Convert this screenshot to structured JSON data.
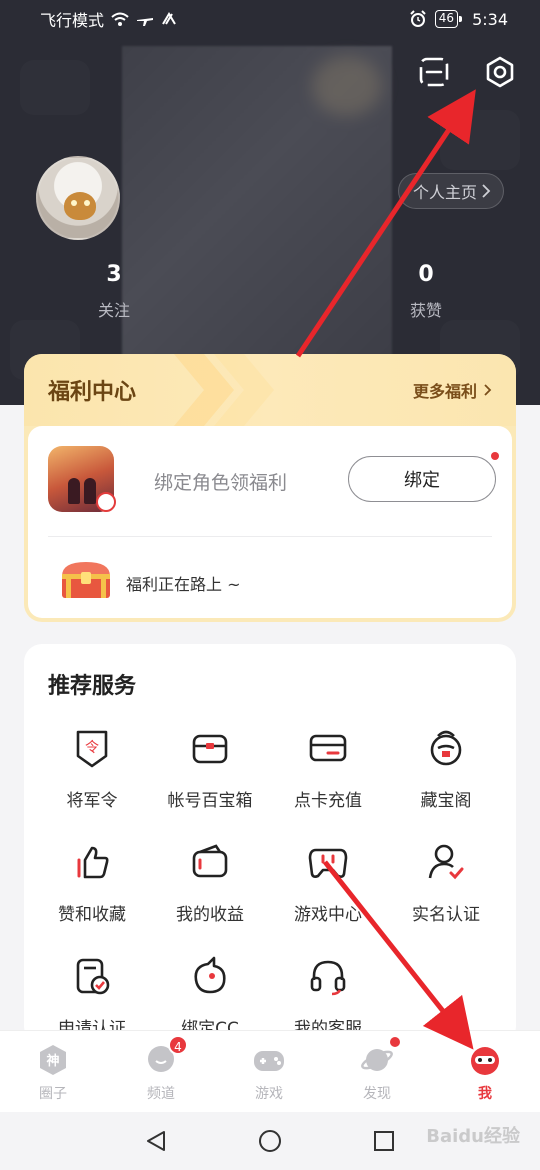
{
  "status_bar": {
    "carrier": "飞行模式",
    "battery": "46",
    "time": "5:34"
  },
  "header": {
    "scan_icon": "scan-icon",
    "settings_icon": "settings-gear-icon",
    "profile_link": "个人主页",
    "stats": [
      {
        "value": "3",
        "label": "关注"
      },
      {
        "value": "0",
        "label": "获赞"
      }
    ]
  },
  "welfare": {
    "title": "福利中心",
    "more": "更多福利",
    "bind_prompt": "绑定角色领福利",
    "bind_button": "绑定",
    "on_the_way": "福利正在路上 ~"
  },
  "services": {
    "title": "推荐服务",
    "items": [
      {
        "label": "将军令",
        "icon": "general-order-icon"
      },
      {
        "label": "帐号百宝箱",
        "icon": "treasure-box-icon"
      },
      {
        "label": "点卡充值",
        "icon": "card-recharge-icon"
      },
      {
        "label": "藏宝阁",
        "icon": "treasure-pavilion-icon"
      },
      {
        "label": "赞和收藏",
        "icon": "thumbs-up-icon"
      },
      {
        "label": "我的收益",
        "icon": "wallet-icon"
      },
      {
        "label": "游戏中心",
        "icon": "gamepad-icon"
      },
      {
        "label": "实名认证",
        "icon": "user-verify-icon"
      },
      {
        "label": "申请认证",
        "icon": "apply-verify-icon"
      },
      {
        "label": "绑定CC",
        "icon": "cc-bind-icon"
      },
      {
        "label": "我的客服",
        "icon": "headset-icon"
      }
    ]
  },
  "tabbar": {
    "tabs": [
      {
        "label": "圈子",
        "icon": "circle-god-icon"
      },
      {
        "label": "频道",
        "icon": "chat-bubble-icon",
        "badge": "4"
      },
      {
        "label": "游戏",
        "icon": "gamepad-icon"
      },
      {
        "label": "发现",
        "icon": "planet-icon"
      },
      {
        "label": "我",
        "icon": "me-mascot-icon"
      }
    ]
  },
  "watermark": "Baidu经验",
  "colors": {
    "header_bg": "#2b2c35",
    "accent": "#e8383d",
    "welfare_bg": "#fbe9b8",
    "welfare_title": "#6b4513"
  }
}
